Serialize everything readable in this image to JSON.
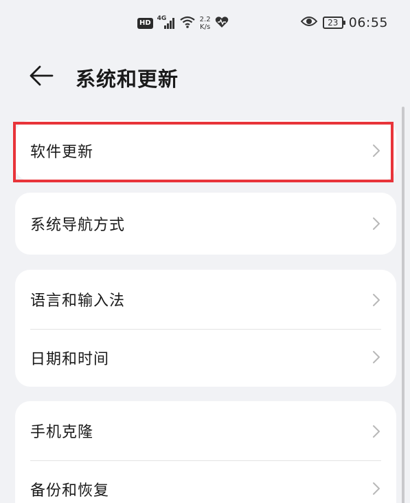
{
  "status_bar": {
    "hd": "HD",
    "network": "4G",
    "speed_value": "2.2",
    "speed_unit": "K/s",
    "battery": "23",
    "time": "06:55"
  },
  "header": {
    "title": "系统和更新"
  },
  "groups": [
    {
      "items": [
        {
          "label": "软件更新"
        }
      ]
    },
    {
      "items": [
        {
          "label": "系统导航方式"
        }
      ]
    },
    {
      "items": [
        {
          "label": "语言和输入法"
        },
        {
          "label": "日期和时间"
        }
      ]
    },
    {
      "items": [
        {
          "label": "手机克隆"
        },
        {
          "label": "备份和恢复"
        }
      ]
    }
  ],
  "colors": {
    "highlight": "#e8343a",
    "background": "#f1f2f5",
    "card": "#ffffff"
  }
}
